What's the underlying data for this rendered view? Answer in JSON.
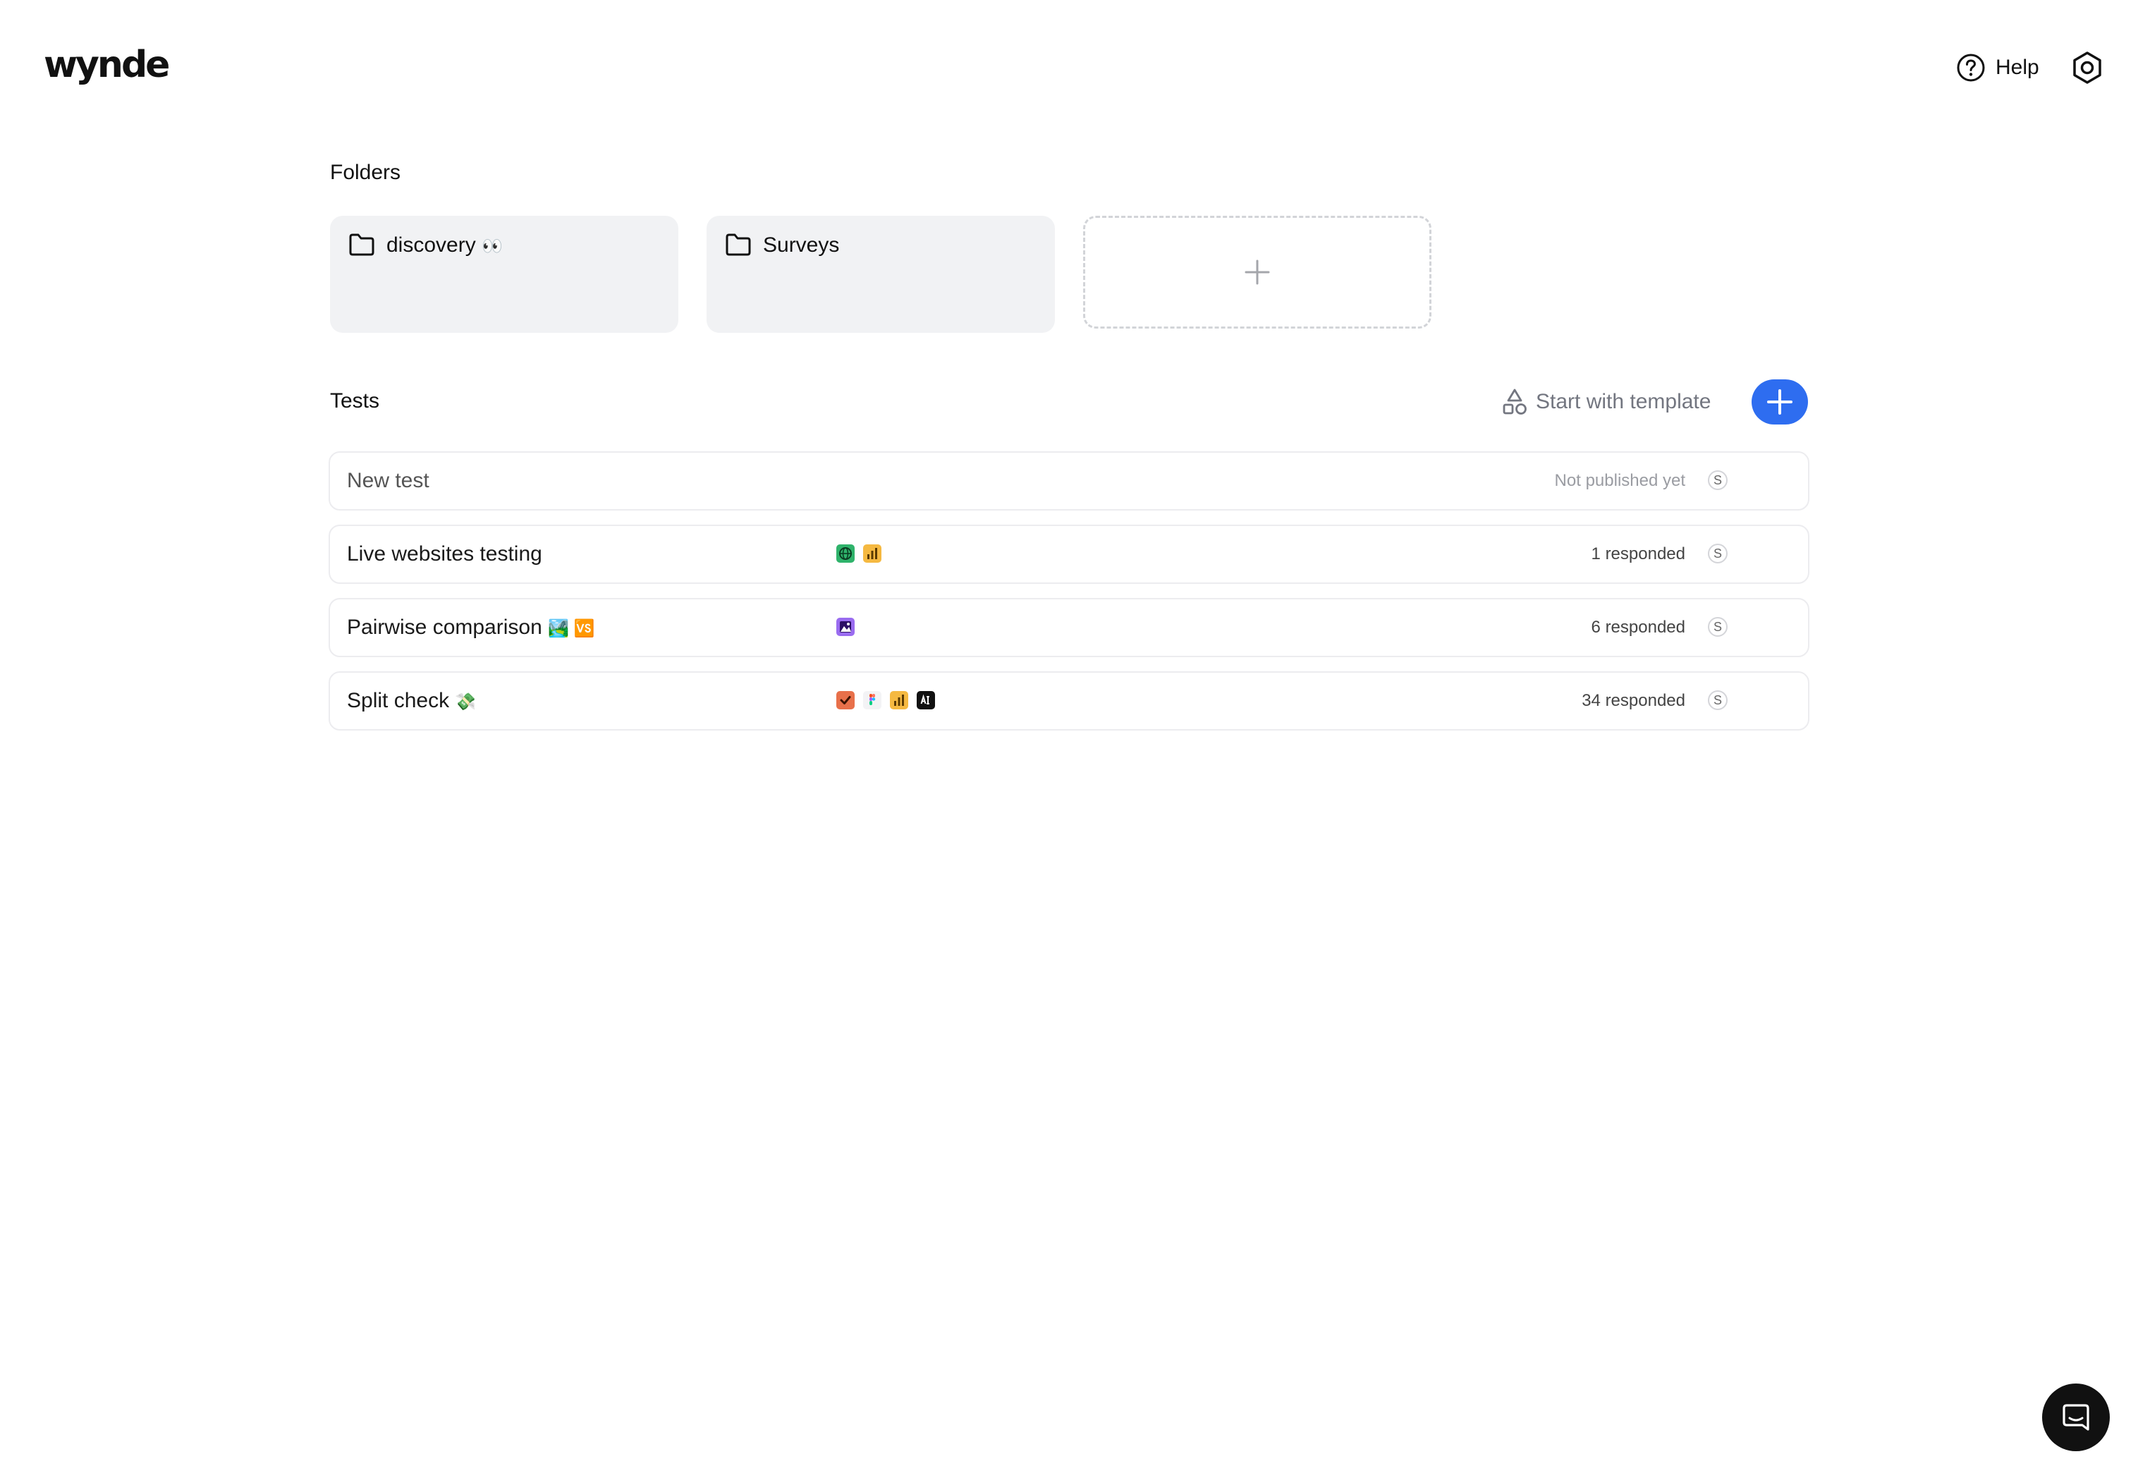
{
  "header": {
    "logo": "wynde",
    "help_label": "Help"
  },
  "folders_section": {
    "title": "Folders",
    "folders": [
      {
        "name": "discovery",
        "emoji": "👀"
      },
      {
        "name": "Surveys",
        "emoji": ""
      }
    ]
  },
  "tests_section": {
    "title": "Tests",
    "template_label": "Start with template",
    "tests": [
      {
        "name": "New test",
        "emoji": "",
        "status": "Not published yet",
        "owner": "S",
        "apps": []
      },
      {
        "name": "Live websites testing",
        "emoji": "",
        "status": "1 responded",
        "owner": "S",
        "apps": [
          "globe-icon",
          "chart-icon"
        ]
      },
      {
        "name": "Pairwise comparison",
        "emoji": "🏞️ 🆚",
        "status": "6 responded",
        "owner": "S",
        "apps": [
          "image-icon"
        ]
      },
      {
        "name": "Split check",
        "emoji": "💸",
        "status": "34 responded",
        "owner": "S",
        "apps": [
          "checkbox-icon",
          "figma-icon",
          "chart-icon",
          "ai-icon"
        ]
      }
    ]
  },
  "colors": {
    "accent": "#2e6df0",
    "folder_bg": "#f1f2f4",
    "chat_launcher": "#111111"
  }
}
